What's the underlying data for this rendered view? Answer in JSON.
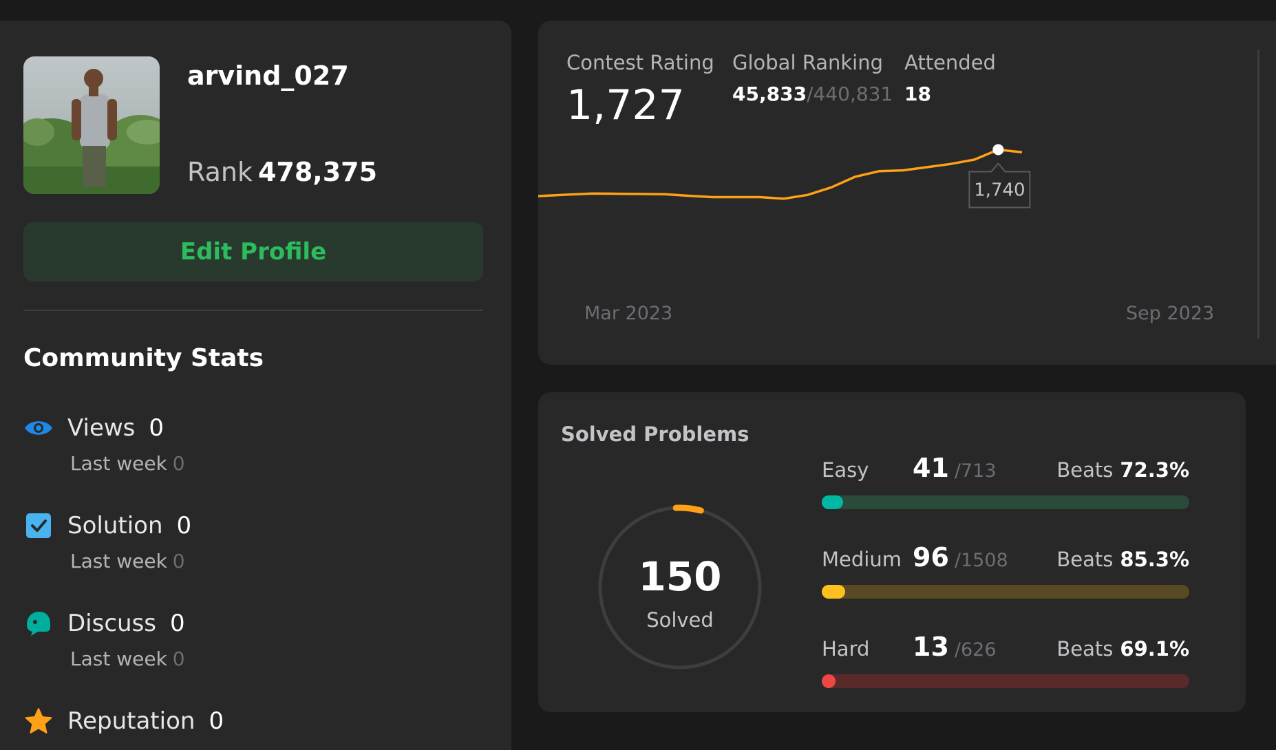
{
  "profile": {
    "username": "arvind_027",
    "rank_label": "Rank",
    "rank_value": "478,375",
    "edit_profile_label": "Edit Profile"
  },
  "community": {
    "title": "Community Stats",
    "last_week_label": "Last week",
    "stats": [
      {
        "name": "Views",
        "value": "0",
        "last_week": "0",
        "icon": "eye-icon",
        "color": "#1e88e5"
      },
      {
        "name": "Solution",
        "value": "0",
        "last_week": "0",
        "icon": "check-square-icon",
        "color": "#49b3f0"
      },
      {
        "name": "Discuss",
        "value": "0",
        "last_week": "0",
        "icon": "chat-bubble-icon",
        "color": "#00af9b"
      },
      {
        "name": "Reputation",
        "value": "0",
        "icon": "star-icon",
        "color": "#ffa116"
      }
    ]
  },
  "contest": {
    "rating_label": "Contest Rating",
    "rating_value": "1,727",
    "ranking_label": "Global Ranking",
    "ranking_value": "45,833",
    "ranking_total": "/440,831",
    "attended_label": "Attended",
    "attended_value": "18",
    "tooltip_value": "1,740",
    "line_color": "#ffa116"
  },
  "chart_data": {
    "type": "line",
    "x_start_label": "Mar 2023",
    "x_end_label": "Sep 2023",
    "values": [
      1497,
      1503,
      1509,
      1515,
      1520,
      1519,
      1518,
      1517,
      1509,
      1502,
      1502,
      1502,
      1494,
      1513,
      1551,
      1604,
      1632,
      1636,
      1652,
      1668,
      1690,
      1740,
      1727
    ],
    "highlighted_value": 1740,
    "grid": false
  },
  "solved": {
    "title": "Solved Problems",
    "total": "150",
    "total_label": "Solved",
    "beats_label": "Beats",
    "ring_fraction": 0.05,
    "difficulties": [
      {
        "name": "Easy",
        "solved": "41",
        "total": "/713",
        "beats": "72.3%",
        "fraction": 0.0575,
        "color": "#00b8a3",
        "track": "#2a4a3a"
      },
      {
        "name": "Medium",
        "solved": "96",
        "total": "/1508",
        "beats": "85.3%",
        "fraction": 0.0637,
        "color": "#ffc01e",
        "track": "#5a4a24"
      },
      {
        "name": "Hard",
        "solved": "13",
        "total": "/626",
        "beats": "69.1%",
        "fraction": 0.0208,
        "color": "#ef4743",
        "track": "#5a2a2a"
      }
    ]
  }
}
